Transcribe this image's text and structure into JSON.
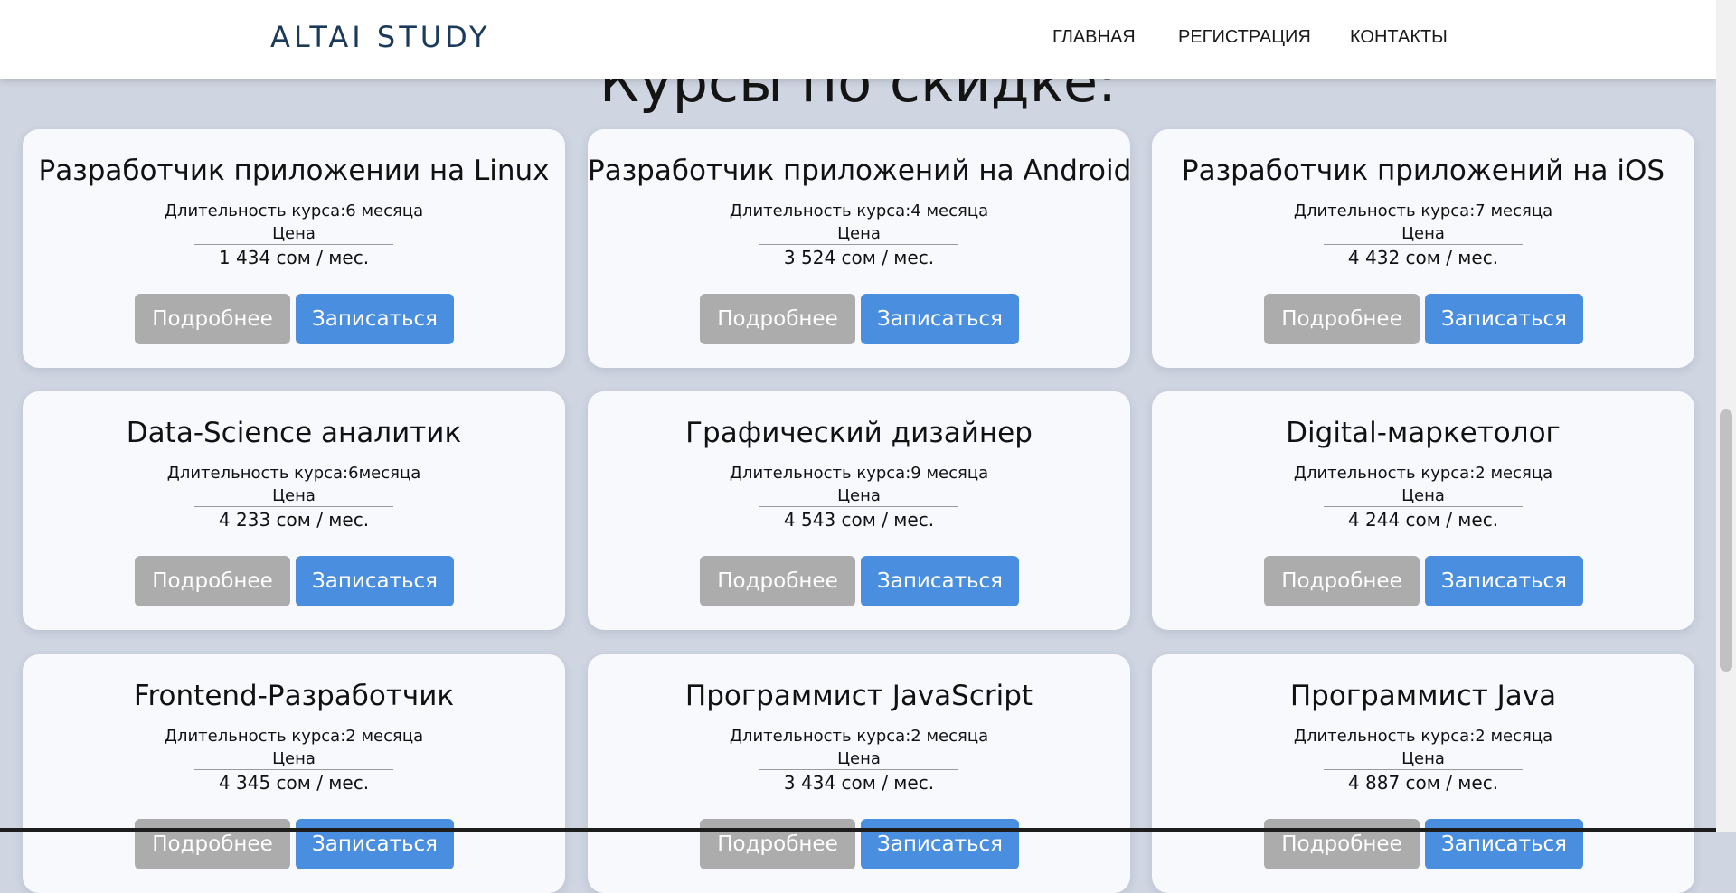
{
  "header": {
    "brand": "ALTAI STUDY",
    "nav": [
      "ГЛАВНАЯ",
      "РЕГИСТРАЦИЯ",
      "КОНТАКТЫ"
    ]
  },
  "page_heading": "Курсы по скидке:",
  "card_labels": {
    "price_label": "Цена",
    "more_button": "Подробнее",
    "enroll_button": "Записаться"
  },
  "courses": [
    {
      "title": "Разработчик приложении на Linux",
      "duration": "Длительность курса:6 месяца",
      "price": "1 434 сом / мес."
    },
    {
      "title": "Разработчик приложений на Android",
      "duration": "Длительность курса:4 месяца",
      "price": "3 524 сом / мес."
    },
    {
      "title": "Разработчик приложений на iOS",
      "duration": "Длительность курса:7 месяца",
      "price": "4 432 сом / мес."
    },
    {
      "title": "Data-Science аналитик",
      "duration": "Длительность курса:6месяца",
      "price": "4 233 сом / мес."
    },
    {
      "title": "Графический дизайнер",
      "duration": "Длительность курса:9 месяца",
      "price": "4 543 сом / мес."
    },
    {
      "title": "Digital-маркетолог",
      "duration": "Длительность курса:2 месяца",
      "price": "4 244 сом / мес."
    },
    {
      "title": "Frontend-Разработчик",
      "duration": "Длительность курса:2 месяца",
      "price": "4 345 сом / мес."
    },
    {
      "title": "Программист JavaScript",
      "duration": "Длительность курса:2 месяца",
      "price": "3 434 сом / мес."
    },
    {
      "title": "Программист Java",
      "duration": "Длительность курса:2 месяца",
      "price": "4 887 сом / мес."
    }
  ],
  "colors": {
    "background": "#cfd5e1",
    "brand": "#1c3a5c",
    "button_more": "#acacac",
    "button_enroll": "#4a8ee0"
  }
}
